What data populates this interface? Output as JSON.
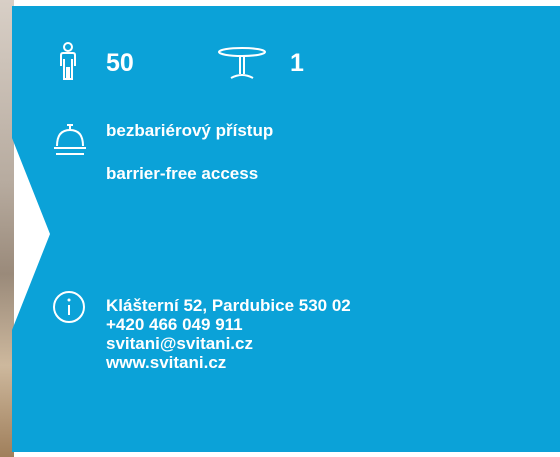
{
  "capacity": {
    "persons": "50",
    "tables": "1"
  },
  "access": {
    "cs": "bezbariérový přístup",
    "en": "barrier-free access"
  },
  "contact": {
    "address": "Klášterní 52, Pardubice 530 02",
    "phone": "+420 466 049 911",
    "email": "svitani@svitani.cz",
    "web": "www.svitani.cz"
  },
  "colors": {
    "panel": "#0ba2d8",
    "text": "#ffffff"
  },
  "icons": [
    "person-icon",
    "table-icon",
    "reception-bell-icon",
    "info-icon"
  ]
}
